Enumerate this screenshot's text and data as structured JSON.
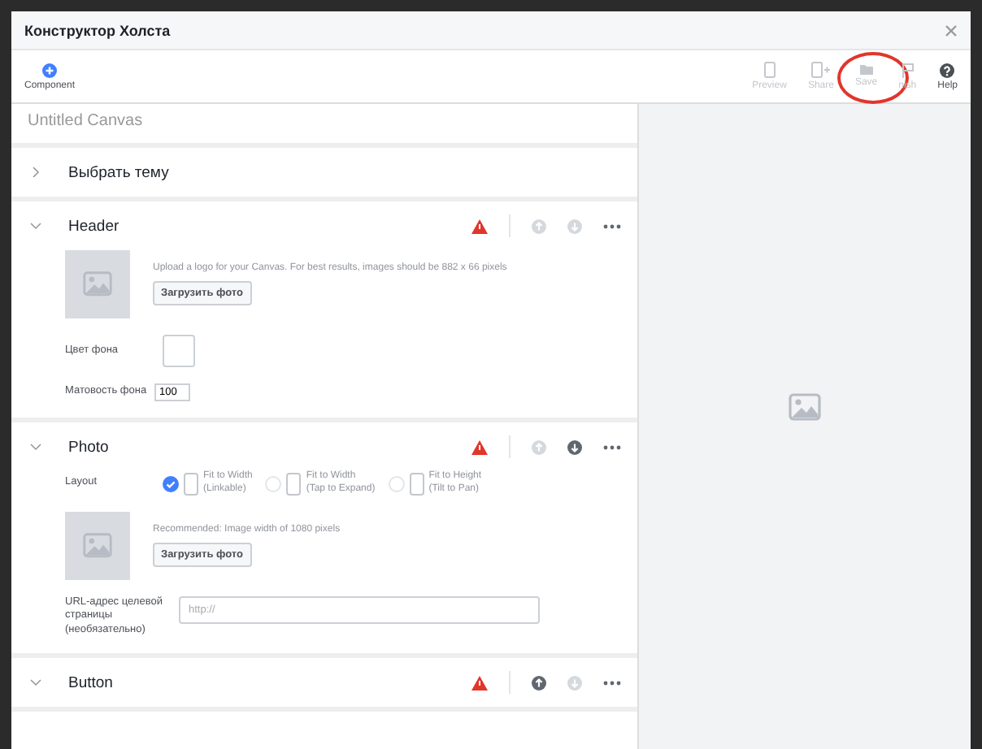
{
  "window": {
    "title": "Конструктор Холста"
  },
  "toolbar": {
    "left": [
      {
        "label": "Component",
        "disabled": false
      }
    ],
    "right": [
      {
        "label": "Preview",
        "disabled": true
      },
      {
        "label": "Share",
        "disabled": true
      },
      {
        "label": "Save",
        "disabled": true,
        "highlighted": true
      },
      {
        "label": "nish",
        "disabled": true
      },
      {
        "label": "Help",
        "disabled": false
      }
    ]
  },
  "canvas_name": {
    "placeholder": "Untitled Canvas"
  },
  "sections": [
    {
      "title": "Выбрать тему",
      "expanded": false
    },
    {
      "title": "Header",
      "expanded": true,
      "warning": true,
      "up_disabled": true,
      "down_disabled": true,
      "fields": [
        {
          "kind": "upload",
          "hint": "Upload a logo for your Canvas. For best results, images should be 882 x 66 pixels",
          "button": "Загрузить фото"
        },
        {
          "kind": "color",
          "label": "Цвет фона"
        },
        {
          "kind": "number",
          "label": "Матовость фона",
          "value": "100"
        }
      ]
    },
    {
      "title": "Photo",
      "expanded": true,
      "warning": true,
      "up_disabled": true,
      "down_disabled": false,
      "fields": [
        {
          "kind": "layout",
          "label": "Layout",
          "options": [
            {
              "line1": "Fit to Width",
              "line2": "(Linkable)",
              "selected": true
            },
            {
              "line1": "Fit to Width",
              "line2": "(Tap to Expand)",
              "selected": false
            },
            {
              "line1": "Fit to Height",
              "line2": "(Tilt to Pan)",
              "selected": false
            }
          ]
        },
        {
          "kind": "upload",
          "hint": "Recommended: Image width of 1080 pixels",
          "button": "Загрузить фото"
        },
        {
          "kind": "url",
          "label": "URL-адрес целевой страницы (необязательно)",
          "placeholder": "http://"
        }
      ]
    },
    {
      "title": "Button",
      "expanded": true,
      "warning": true,
      "up_disabled": false,
      "down_disabled": true
    }
  ]
}
